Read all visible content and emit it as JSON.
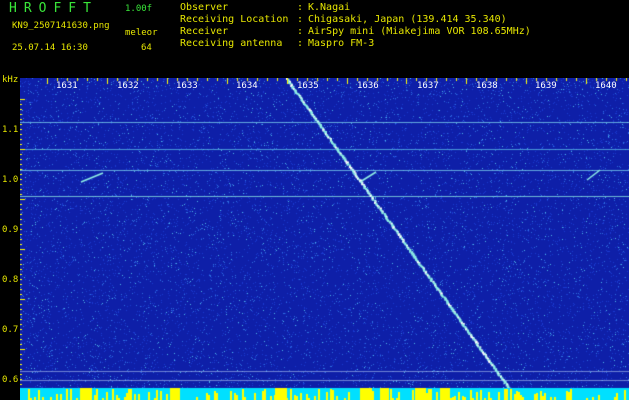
{
  "header": {
    "app_title": "HROFFT",
    "version": "1.00f",
    "filename": "KN9_2507141630.png",
    "datetime": "25.07.14 16:30",
    "mode_label": "meleor",
    "mode_value": "64",
    "fields": [
      {
        "key": "Observer",
        "value": "K.Nagai"
      },
      {
        "key": "Receiving Location",
        "value": "Chigasaki, Japan (139.414 35.340)"
      },
      {
        "key": "Receiver",
        "value": "AirSpy mini (Miakejima VOR 108.65MHz)"
      },
      {
        "key": "Receiving antenna",
        "value": "Maspro FM-3"
      }
    ],
    "separator": ":"
  },
  "spectrogram": {
    "y_axis_unit": "kHz",
    "y_ticks": [
      "1.1",
      "1.0",
      "0.9",
      "0.8",
      "0.7",
      "0.6"
    ],
    "x_ticks": [
      "1631",
      "1632",
      "1633",
      "1634",
      "1635",
      "1636",
      "1637",
      "1638",
      "1639",
      "1640"
    ],
    "colors": {
      "background": "#0e1fa8",
      "noise_low": "#1a3ad0",
      "noise_high": "#4fb8e8",
      "trace": "#8ff0e6",
      "bottom_bar": "#00e0ff",
      "burst": "#ffff00",
      "tick": "#ffff00"
    }
  }
}
